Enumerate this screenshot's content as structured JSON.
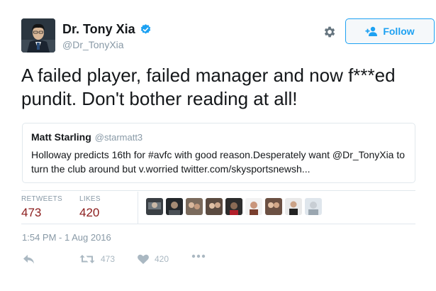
{
  "author": {
    "name": "Dr. Tony Xia",
    "handle": "@Dr_TonyXia",
    "verified": true
  },
  "follow_button": {
    "label": "Follow",
    "icon": "add-user-icon"
  },
  "settings_icon": "gear-icon",
  "tweet": {
    "text": "A failed player, failed manager and now f***ed pundit. Don't bother reading at all!"
  },
  "quoted_tweet": {
    "name": "Matt Starling",
    "handle": "@starmatt3",
    "text": "Holloway predicts 16th for #avfc with good reason.Desperately want @Dr_TonyXia to turn the club around but v.worried twitter.com/skysportsnewsh..."
  },
  "stats": {
    "retweets_label": "RETWEETS",
    "retweets_value": "473",
    "likes_label": "LIKES",
    "likes_value": "420"
  },
  "timestamp": "1:54 PM - 1 Aug 2016",
  "actions": {
    "reply_icon": "reply-icon",
    "retweet_icon": "retweet-icon",
    "retweet_count": "473",
    "like_icon": "heart-icon",
    "like_count": "420",
    "more_icon": "more-icon"
  },
  "colors": {
    "accent": "#1da1f2",
    "stat_value": "#8b1c1c",
    "muted": "#8899a6",
    "action_icon": "#aab8c2",
    "border": "#e1e8ed"
  }
}
